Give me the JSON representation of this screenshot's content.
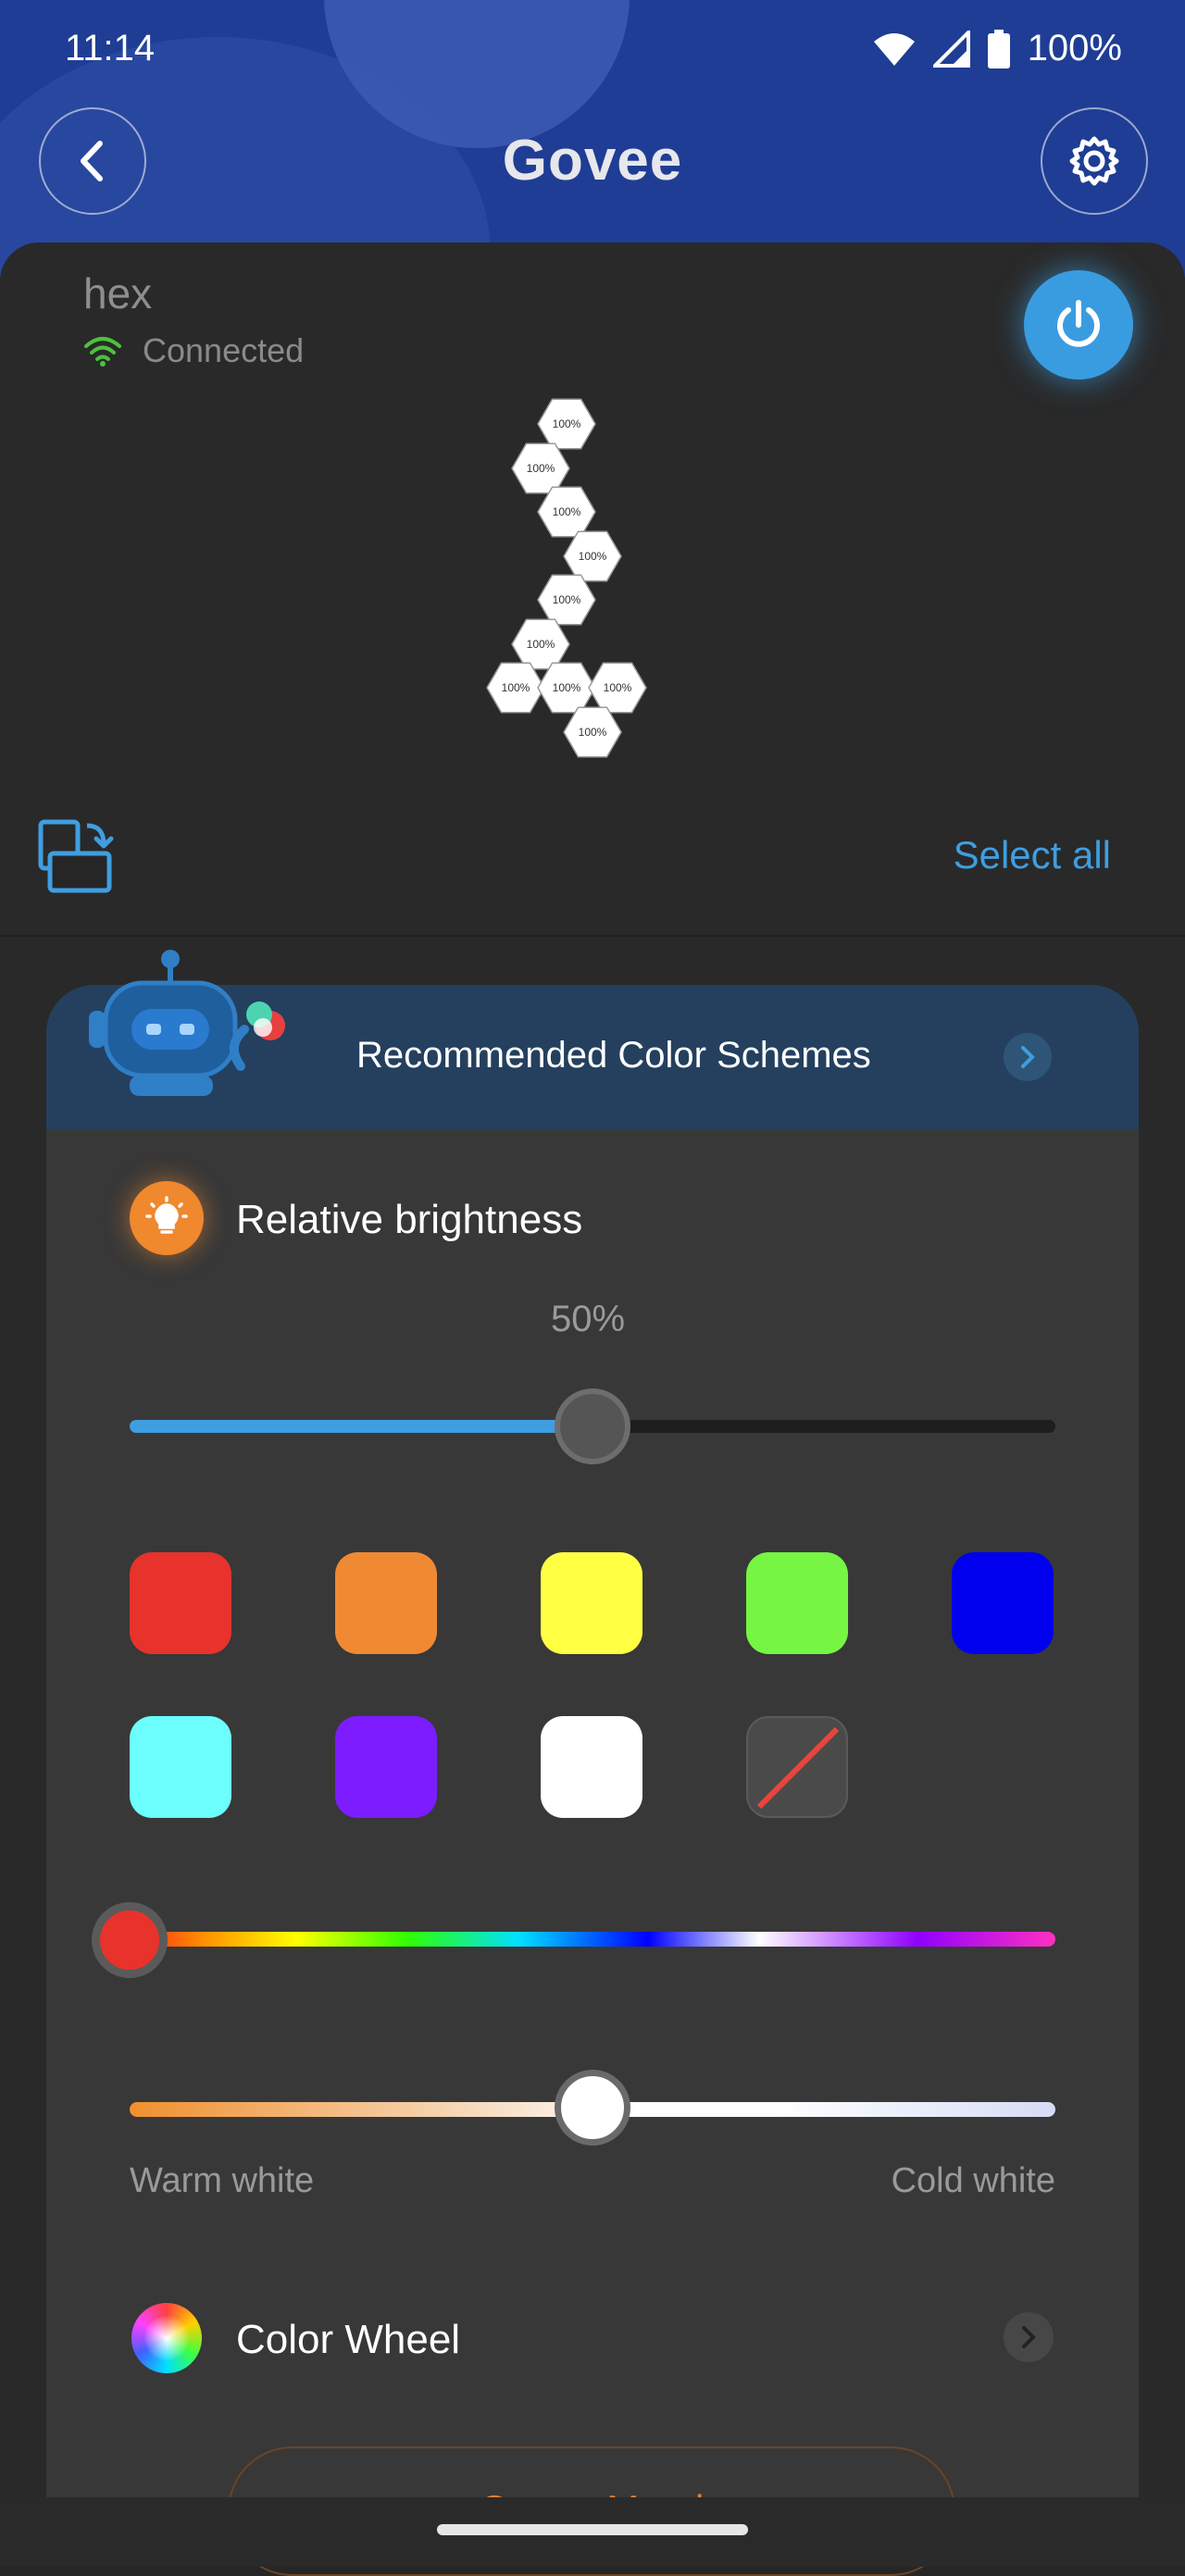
{
  "status_bar": {
    "time": "11:14",
    "battery": "100%"
  },
  "header": {
    "logo": "Govee",
    "back_icon": "chevron-left-icon",
    "settings_icon": "gear-icon"
  },
  "device": {
    "name": "hex",
    "connection": "Connected",
    "power_icon": "power-icon"
  },
  "panels": {
    "label": "100%",
    "tiles": [
      {
        "label": "100%"
      },
      {
        "label": "100%"
      },
      {
        "label": "100%"
      },
      {
        "label": "100%"
      },
      {
        "label": "100%"
      },
      {
        "label": "100%"
      },
      {
        "label": "100%"
      },
      {
        "label": "100%"
      },
      {
        "label": "100%"
      },
      {
        "label": "100%"
      }
    ]
  },
  "selection": {
    "select_all": "Select all"
  },
  "recommended": {
    "title": "Recommended Color Schemes"
  },
  "brightness": {
    "label": "Relative brightness",
    "value_text": "50%",
    "value": 0.5
  },
  "swatches": [
    {
      "name": "red",
      "color": "#e8322c"
    },
    {
      "name": "orange",
      "color": "#f08a32"
    },
    {
      "name": "yellow",
      "color": "#ffff44"
    },
    {
      "name": "green",
      "color": "#76f542"
    },
    {
      "name": "blue",
      "color": "#0000ee"
    },
    {
      "name": "cyan",
      "color": "#6cfdfd"
    },
    {
      "name": "purple",
      "color": "#7d1cff"
    },
    {
      "name": "white",
      "color": "#ffffff"
    },
    {
      "name": "none",
      "color": "#4a4a4a"
    }
  ],
  "hue_slider": {
    "value": 0.0
  },
  "white_temp": {
    "warm_label": "Warm white",
    "cold_label": "Cold white",
    "value": 0.5
  },
  "color_wheel": {
    "label": "Color Wheel"
  },
  "mood": {
    "label": "Create Mood"
  }
}
